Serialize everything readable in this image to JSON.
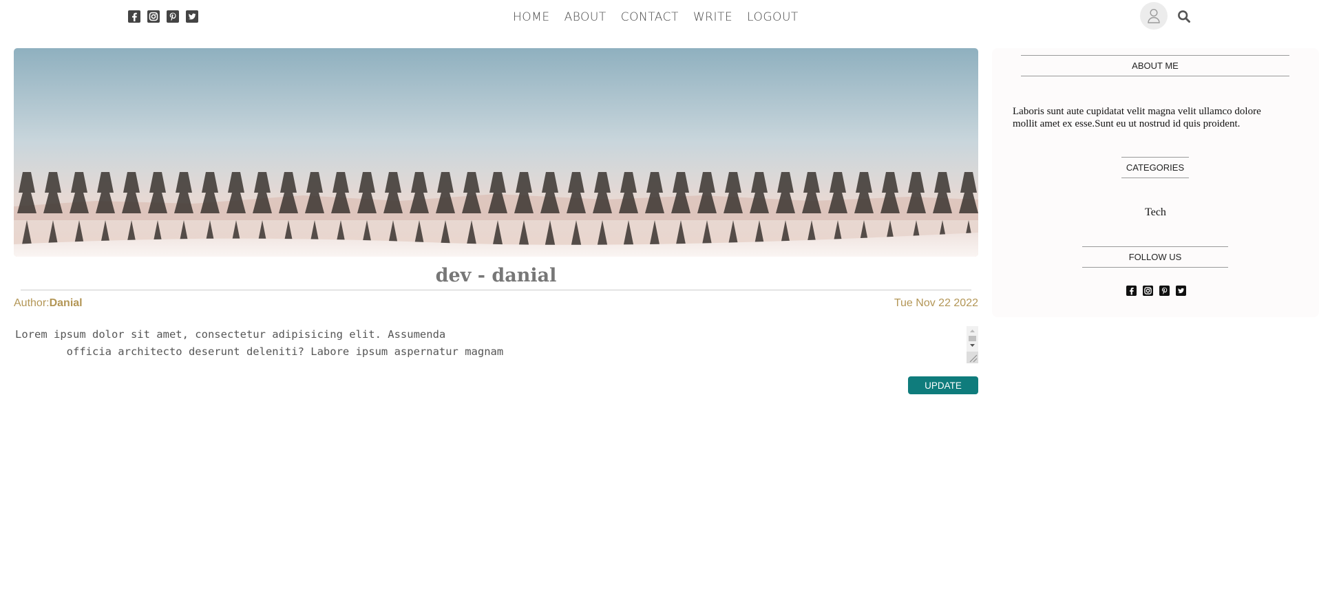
{
  "header": {
    "social_icons": [
      "facebook-square-icon",
      "instagram-icon",
      "pinterest-square-icon",
      "twitter-square-icon"
    ],
    "nav": [
      {
        "label": "HOME"
      },
      {
        "label": "ABOUT"
      },
      {
        "label": "CONTACT"
      },
      {
        "label": "WRITE"
      },
      {
        "label": "LOGOUT"
      }
    ],
    "right_icons": [
      "user-icon",
      "search-icon"
    ]
  },
  "post": {
    "title": "dev - danial",
    "author_label": "Author:",
    "author_name": "Danial",
    "date": "Tue Nov 22 2022",
    "body": "Lorem ipsum dolor sit amet, consectetur adipisicing elit. Assumenda\n        officia architecto deserunt deleniti? Labore ipsum aspernatur magnam",
    "update_label": "UPDATE"
  },
  "sidebar": {
    "about_title": "ABOUT ME",
    "about_text": "Laboris sunt aute cupidatat velit magna velit ullamco dolore mollit amet ex esse.Sunt eu ut nostrud id quis proident.",
    "categories_title": "CATEGORIES",
    "categories": [
      "Tech"
    ],
    "follow_title": "FOLLOW US",
    "follow_icons": [
      "facebook-square-icon",
      "instagram-icon",
      "pinterest-square-icon",
      "twitter-square-icon"
    ]
  },
  "colors": {
    "accent_gold": "#b39656",
    "button_teal": "#0f7c7c",
    "sidebar_bg": "#fdfbfb"
  }
}
